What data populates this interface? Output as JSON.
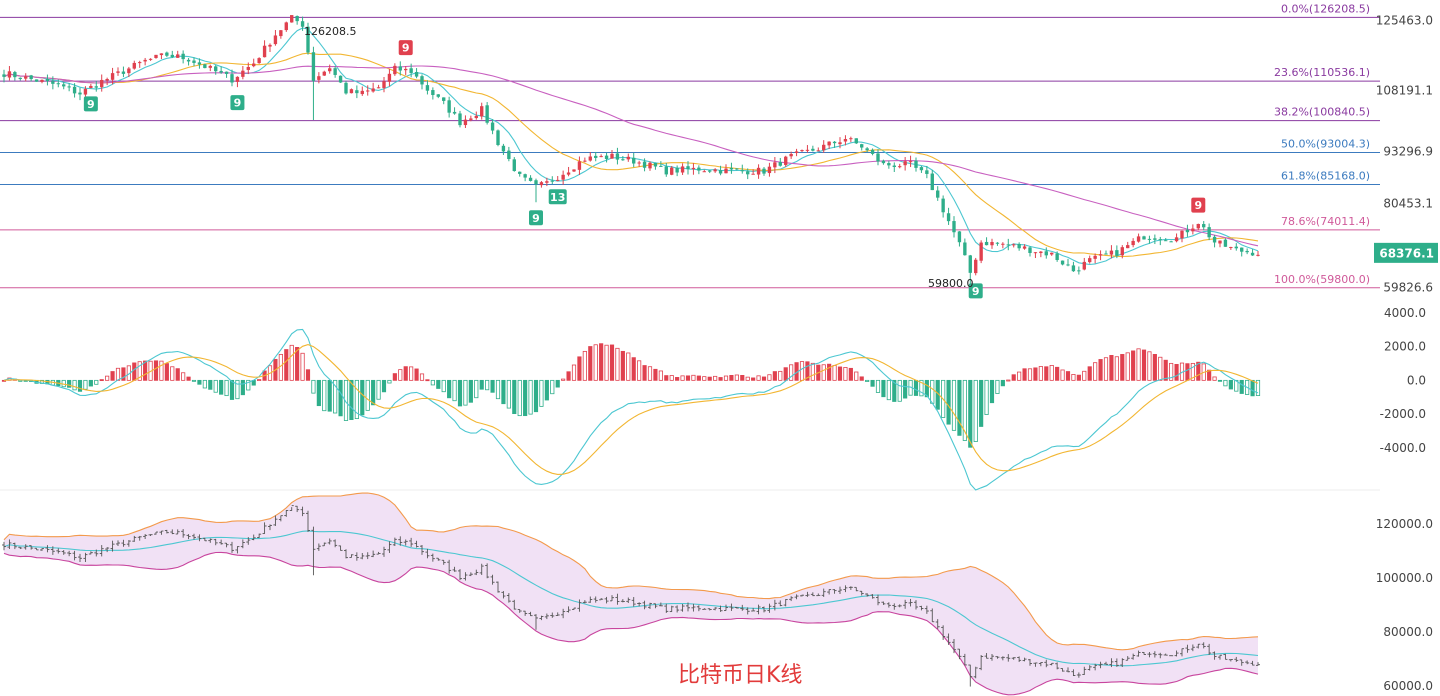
{
  "caption": "比特币日K线",
  "colors": {
    "up": "#e0404e",
    "down": "#2eae8a",
    "fib_purple": "#8a3aa0",
    "fib_blue": "#3c7bbf",
    "fib_pink": "#d05a9a",
    "ma_yellow": "#f2b632",
    "ma_cyan": "#4cc7d1",
    "ma_pink": "#c860c0",
    "boll_fill": "#ecd7f2",
    "boll_upper": "#f39a4c",
    "boll_lower": "#c8459e",
    "last_price_bg": "#2eae8a"
  },
  "price_axis": {
    "ticks": [
      "125463.0",
      "108191.1",
      "93296.9",
      "80453.1",
      "59826.6"
    ],
    "last_price": "68376.1"
  },
  "macd_axis": {
    "ticks": [
      "4000.0",
      "2000.0",
      "0.0",
      "-2000.0",
      "-4000.0"
    ]
  },
  "boll_axis": {
    "ticks": [
      "120000.0",
      "100000.0",
      "80000.0",
      "60000.0"
    ]
  },
  "fib_levels": [
    {
      "label": "0.0%(126208.5)",
      "value": 126208.5,
      "color": "purple"
    },
    {
      "label": "23.6%(110536.1)",
      "value": 110536.1,
      "color": "purple"
    },
    {
      "label": "38.2%(100840.5)",
      "value": 100840.5,
      "color": "purple"
    },
    {
      "label": "50.0%(93004.3)",
      "value": 93004.3,
      "color": "blue"
    },
    {
      "label": "61.8%(85168.0)",
      "value": 85168.0,
      "color": "blue"
    },
    {
      "label": "78.6%(74011.4)",
      "value": 74011.4,
      "color": "pink"
    },
    {
      "label": "100.0%(59800.0)",
      "value": 59800.0,
      "color": "pink"
    }
  ],
  "annotations": {
    "high": "126208.5",
    "low": "59800.0"
  },
  "td_markers": [
    {
      "text": "9",
      "type": "buy",
      "index": 16
    },
    {
      "text": "9",
      "type": "buy",
      "index": 43
    },
    {
      "text": "9",
      "type": "sell",
      "index": 74
    },
    {
      "text": "9",
      "type": "buy",
      "index": 98
    },
    {
      "text": "13",
      "type": "buy",
      "index": 102
    },
    {
      "text": "9",
      "type": "buy",
      "index": 179
    },
    {
      "text": "9",
      "type": "sell",
      "index": 220
    }
  ],
  "chart_data": {
    "type": "candlestick",
    "title": "比特币日K线",
    "price_range": [
      56800,
      128500
    ],
    "macd_range": [
      -6500,
      5000
    ],
    "boll_range": [
      60000,
      127000
    ],
    "anchors": [
      [
        0,
        112500
      ],
      [
        5,
        111000
      ],
      [
        10,
        109500
      ],
      [
        14,
        107500
      ],
      [
        18,
        110500
      ],
      [
        22,
        113000
      ],
      [
        26,
        115500
      ],
      [
        30,
        117000
      ],
      [
        34,
        116000
      ],
      [
        38,
        113500
      ],
      [
        42,
        111000
      ],
      [
        46,
        115000
      ],
      [
        50,
        122000
      ],
      [
        53,
        126000
      ],
      [
        55,
        124500
      ],
      [
        57,
        111000
      ],
      [
        60,
        114000
      ],
      [
        63,
        108000
      ],
      [
        66,
        107500
      ],
      [
        69,
        109000
      ],
      [
        72,
        113500
      ],
      [
        75,
        113000
      ],
      [
        78,
        108500
      ],
      [
        81,
        105000
      ],
      [
        84,
        100500
      ],
      [
        88,
        103500
      ],
      [
        91,
        95500
      ],
      [
        95,
        87000
      ],
      [
        98,
        84500
      ],
      [
        100,
        85500
      ],
      [
        103,
        88000
      ],
      [
        107,
        91500
      ],
      [
        112,
        92000
      ],
      [
        116,
        91000
      ],
      [
        122,
        88500
      ],
      [
        128,
        89000
      ],
      [
        134,
        88500
      ],
      [
        140,
        88500
      ],
      [
        145,
        92000
      ],
      [
        150,
        94000
      ],
      [
        155,
        96500
      ],
      [
        158,
        94500
      ],
      [
        162,
        90000
      ],
      [
        167,
        90000
      ],
      [
        170,
        87000
      ],
      [
        173,
        79000
      ],
      [
        176,
        70500
      ],
      [
        178,
        63500
      ],
      [
        180,
        71000
      ],
      [
        184,
        70500
      ],
      [
        188,
        69500
      ],
      [
        193,
        68000
      ],
      [
        197,
        64000
      ],
      [
        200,
        66500
      ],
      [
        205,
        68500
      ],
      [
        210,
        72500
      ],
      [
        216,
        72000
      ],
      [
        220,
        76000
      ],
      [
        223,
        71000
      ],
      [
        227,
        69000
      ],
      [
        231,
        68376
      ]
    ]
  }
}
